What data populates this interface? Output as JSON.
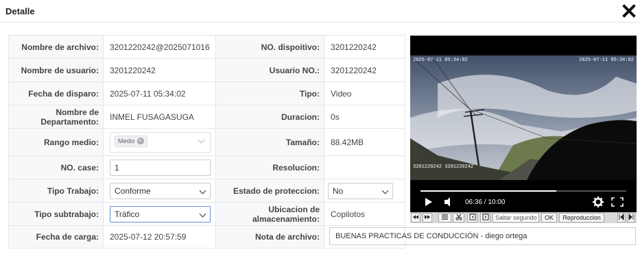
{
  "dialog": {
    "title": "Detalle"
  },
  "labels": {
    "nombre_archivo": "Nombre de archivo:",
    "nombre_usuario": "Nombre de usuario:",
    "fecha_disparo": "Fecha de disparo:",
    "nombre_departamento": "Nombre de Departamento:",
    "rango_medio": "Rango medio:",
    "no_case": "NO. case:",
    "tipo_trabajo": "Tipo Trabajo:",
    "tipo_subtrabajo": "Tipo subtrabajo:",
    "fecha_carga": "Fecha de carga:",
    "no_dispositivo": "NO. dispoitivo:",
    "usuario_no": "Usuario NO.:",
    "tipo": "Tipo:",
    "duracion": "Duracion:",
    "tamano": "Tamaño:",
    "resolucion": "Resolucion:",
    "estado_proteccion": "Estado de proteccion:",
    "ubicacion": "Ubicacion de almacenamiento:",
    "nota_archivo": "Nota de archivo:"
  },
  "values": {
    "nombre_archivo": "3201220242@2025071016",
    "nombre_usuario": "3201220242",
    "fecha_disparo": "2025-07-11 05:34:02",
    "nombre_departamento": "INMEL FUSAGASUGA",
    "rango_medio_tag": "Medio",
    "no_case": "1",
    "tipo_trabajo": "Conforme",
    "tipo_subtrabajo": "Tráfico",
    "fecha_carga": "2025-07-12 20:57:59",
    "no_dispositivo": "3201220242",
    "usuario_no": "3201220242",
    "tipo": "Video",
    "duracion": "0s",
    "tamano": "88.42MB",
    "resolucion": "",
    "estado_proteccion": "No",
    "ubicacion": "Copilotos",
    "nota_archivo": "BUENAS PRACTICAS DE CONDUCCIÓN - diego ortega"
  },
  "video": {
    "overlay_left": "2025-07-11 05:34:02",
    "overlay_right": "2025-07-11 05:34:02",
    "overlay_bottom": "3201220242 3201220242",
    "time": "06:36 / 10:00",
    "progress": 0.66
  },
  "controls": {
    "skip_placeholder": "Saltar segundo",
    "ok": "OK",
    "reproduccion": "Reproduccion"
  }
}
